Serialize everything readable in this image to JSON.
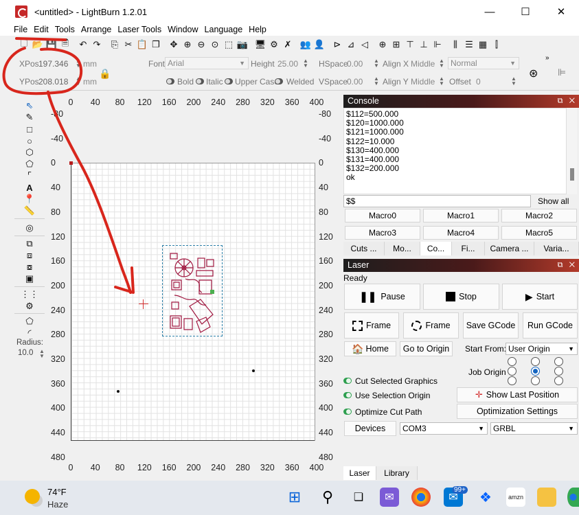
{
  "window": {
    "title": "<untitled> - LightBurn 1.2.01",
    "minimize": "—",
    "maximize": "☐",
    "close": "✕"
  },
  "menu": [
    "File",
    "Edit",
    "Tools",
    "Arrange",
    "Laser Tools",
    "Window",
    "Language",
    "Help"
  ],
  "textbar": {
    "xpos_label": "XPos",
    "xpos_value": "197.346",
    "ypos_label": "YPos",
    "ypos_value": "208.018",
    "unit": "mm",
    "font_label": "Font",
    "font_value": "Arial",
    "height_label": "Height",
    "height_value": "25.00",
    "hspace_label": "HSpace",
    "hspace_value": "0.00",
    "vspace_label": "VSpace",
    "vspace_value": "0.00",
    "alignx_label": "Align X",
    "alignx_value": "Middle",
    "aligny_label": "Align Y",
    "aligny_value": "Middle",
    "style_value": "Normal",
    "offset_label": "Offset",
    "offset_value": "0",
    "bold": "Bold",
    "italic": "Italic",
    "upper_case": "Upper Case",
    "welded": "Welded"
  },
  "tools": {
    "radius_label": "Radius:",
    "radius_value": "10.0"
  },
  "rulers": {
    "x_ticks": [
      "0",
      "40",
      "80",
      "120",
      "160",
      "200",
      "240",
      "280",
      "320",
      "360",
      "400"
    ],
    "y_ticks_left": [
      "-80",
      "-40",
      "0",
      "40",
      "80",
      "120",
      "160",
      "200",
      "240",
      "280",
      "320",
      "360",
      "400",
      "440",
      "480"
    ],
    "y_ticks_right": [
      "-80",
      "-40",
      "0",
      "40",
      "80",
      "120",
      "160",
      "200",
      "240",
      "280",
      "320",
      "360",
      "400",
      "440",
      "480"
    ]
  },
  "console": {
    "title": "Console",
    "lines": [
      "$112=500.000",
      "$120=1000.000",
      "$121=1000.000",
      "$122=10.000",
      "$130=400.000",
      "$131=400.000",
      "$132=200.000",
      "ok"
    ],
    "input_value": "$$",
    "show_all": "Show all",
    "macros": [
      "Macro0",
      "Macro1",
      "Macro2",
      "Macro3",
      "Macro4",
      "Macro5"
    ],
    "tabs": [
      "Cuts ...",
      "Mo...",
      "Co...",
      "Fi...",
      "Camera ...",
      "Varia..."
    ]
  },
  "laser": {
    "title": "Laser",
    "status": "Ready",
    "pause": "Pause",
    "stop": "Stop",
    "start": "Start",
    "frame1": "Frame",
    "frame2": "Frame",
    "save_gcode": "Save GCode",
    "run_gcode": "Run GCode",
    "home": "Home",
    "go_to_origin": "Go to Origin",
    "start_from_label": "Start From:",
    "start_from_value": "User Origin",
    "job_origin_label": "Job Origin",
    "cut_selected": "Cut Selected Graphics",
    "use_selection_origin": "Use Selection Origin",
    "optimize_cut_path": "Optimize Cut Path",
    "show_last_position": "Show Last Position",
    "optimization_settings": "Optimization Settings",
    "devices": "Devices",
    "port_value": "COM3",
    "device_value": "GRBL",
    "tabs": [
      "Laser",
      "Library"
    ]
  },
  "taskbar": {
    "temperature": "74°F",
    "condition": "Haze",
    "badge": "99+"
  },
  "colors": {
    "annotation_red": "#d8261c",
    "panel_gradient_end": "#b23a2a",
    "toggle_green": "#2e9f4f",
    "selection_blue": "#2a7fa8"
  }
}
